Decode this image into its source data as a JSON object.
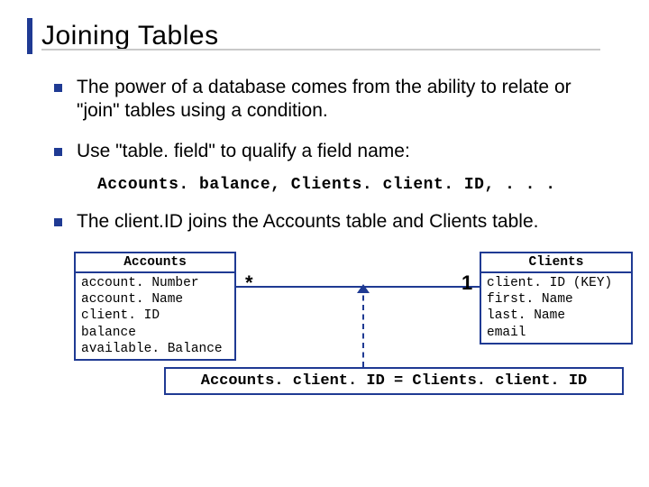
{
  "title": "Joining Tables",
  "bullets": {
    "b1": "The power of a database comes from the ability to relate or \"join\" tables using a condition.",
    "b2": "Use \"table. field\" to qualify a field name:",
    "b3": "The client.ID joins the Accounts table and Clients table."
  },
  "code_example": "Accounts. balance, Clients. client. ID, . . .",
  "diagram": {
    "accounts": {
      "header": "Accounts",
      "fields": [
        "account. Number",
        "account. Name",
        "client. ID",
        "balance",
        "available. Balance"
      ]
    },
    "clients": {
      "header": "Clients",
      "fields": [
        "client. ID (KEY)",
        "first. Name",
        "last. Name",
        "email"
      ]
    },
    "multiplicity_left": "*",
    "multiplicity_right": "1",
    "condition": "Accounts. client. ID = Clients. client. ID"
  }
}
